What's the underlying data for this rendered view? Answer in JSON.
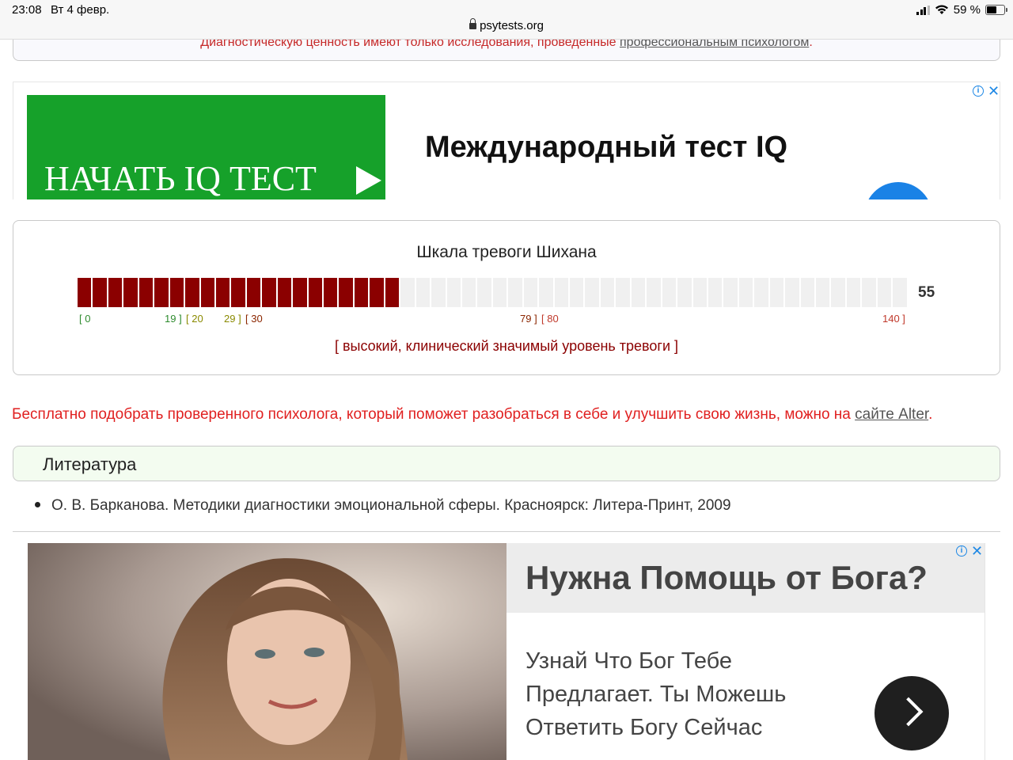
{
  "status_bar": {
    "time": "23:08",
    "date": "Вт 4 февр.",
    "url": "psytests.org",
    "battery": "59 %",
    "battery_level": 0.59
  },
  "notice": {
    "text": "Диагностическую ценность имеют только исследования, проведенные",
    "link": "профессиональным психологом",
    "suffix": "."
  },
  "ad_top": {
    "cta": "НАЧАТЬ IQ ТЕСТ",
    "title": "Международный тест IQ",
    "accent_color": "#16a12a"
  },
  "scale": {
    "title": "Шкала тревоги Шихана",
    "score": "55",
    "score_value": 55,
    "max_value": 140,
    "segments_total": 54,
    "fill_color": "#8b0000",
    "ticks": {
      "t0": "[ 0",
      "t19": "19 ]",
      "t20": "[ 20",
      "t29": "29 ]",
      "t30": "[ 30",
      "t79": "79 ]",
      "t80": "[ 80",
      "t140": "140 ]"
    },
    "verdict": "[ высокий, клинический значимый уровень тревоги ]"
  },
  "promo": {
    "text": "Бесплатно подобрать проверенного психолога, который поможет разобраться в себе и улучшить свою жизнь, можно на ",
    "link": "сайте Alter",
    "suffix": "."
  },
  "literature": {
    "title": "Литература",
    "items": [
      "О. В. Барканова. Методики диагностики эмоциональной сферы. Красноярск: Литера-Принт, 2009"
    ]
  },
  "ad_bottom": {
    "title": "Нужна Помощь от Бога?",
    "body": "Узнай Что Бог Тебе Предлагает. Ты Можешь Ответить Богу Сейчас"
  }
}
